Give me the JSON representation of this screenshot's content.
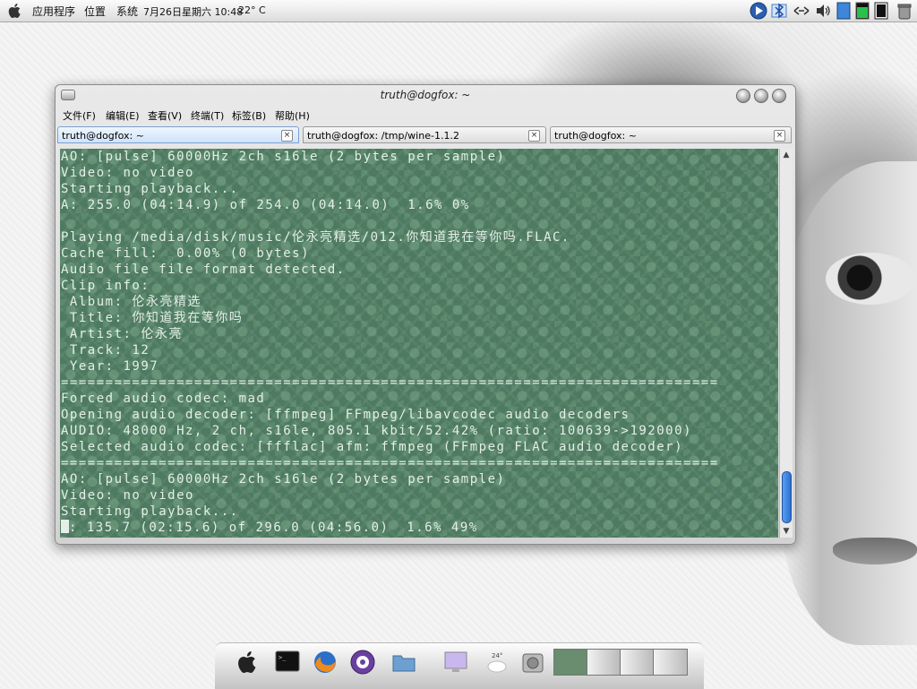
{
  "top_panel": {
    "menu_apps": "应用程序",
    "menu_places": "位置",
    "menu_system": "系统",
    "clock": "7月26日星期六 10:48",
    "weather": "22° C"
  },
  "window": {
    "title": "truth@dogfox: ~",
    "menu": [
      "文件(F)",
      "编辑(E)",
      "查看(V)",
      "终端(T)",
      "标签(B)",
      "帮助(H)"
    ],
    "tabs": [
      {
        "label": "truth@dogfox: ~",
        "close": "×"
      },
      {
        "label": "truth@dogfox: /tmp/wine-1.1.2",
        "close": "×"
      },
      {
        "label": "truth@dogfox: ~",
        "close": "×"
      }
    ],
    "terminal_lines": [
      "AO: [pulse] 60000Hz 2ch s16le (2 bytes per sample)",
      "Video: no video",
      "Starting playback...",
      "A: 255.0 (04:14.9) of 254.0 (04:14.0)  1.6% 0%",
      "",
      "Playing /media/disk/music/伦永亮精选/012.你知道我在等你吗.FLAC.",
      "Cache fill:  0.00% (0 bytes)",
      "Audio file file format detected.",
      "Clip info:",
      " Album: 伦永亮精选",
      " Title: 你知道我在等你吗",
      " Artist: 伦永亮",
      " Track: 12",
      " Year: 1997",
      "==========================================================================",
      "Forced audio codec: mad",
      "Opening audio decoder: [ffmpeg] FFmpeg/libavcodec audio decoders",
      "AUDIO: 48000 Hz, 2 ch, s16le, 805.1 kbit/52.42% (ratio: 100639->192000)",
      "Selected audio codec: [ffflac] afm: ffmpeg (FFmpeg FLAC audio decoder)",
      "==========================================================================",
      "AO: [pulse] 60000Hz 2ch s16le (2 bytes per sample)",
      "Video: no video",
      "Starting playback..."
    ],
    "status_line": ": 135.7 (02:15.6) of 296.0 (04:56.0)  1.6% 49%"
  },
  "dock": {
    "items": [
      "apple-icon",
      "terminal-icon",
      "firefox-icon",
      "pidgin-icon",
      "folder-icon",
      "monitor-icon",
      "weather-icon",
      "harddisk-icon",
      "workspace-switcher"
    ]
  },
  "colors": {
    "terminal_bg": "#4d7a60",
    "terminal_fg": "#e4efe7",
    "active_tab": "#cfe3fb"
  }
}
